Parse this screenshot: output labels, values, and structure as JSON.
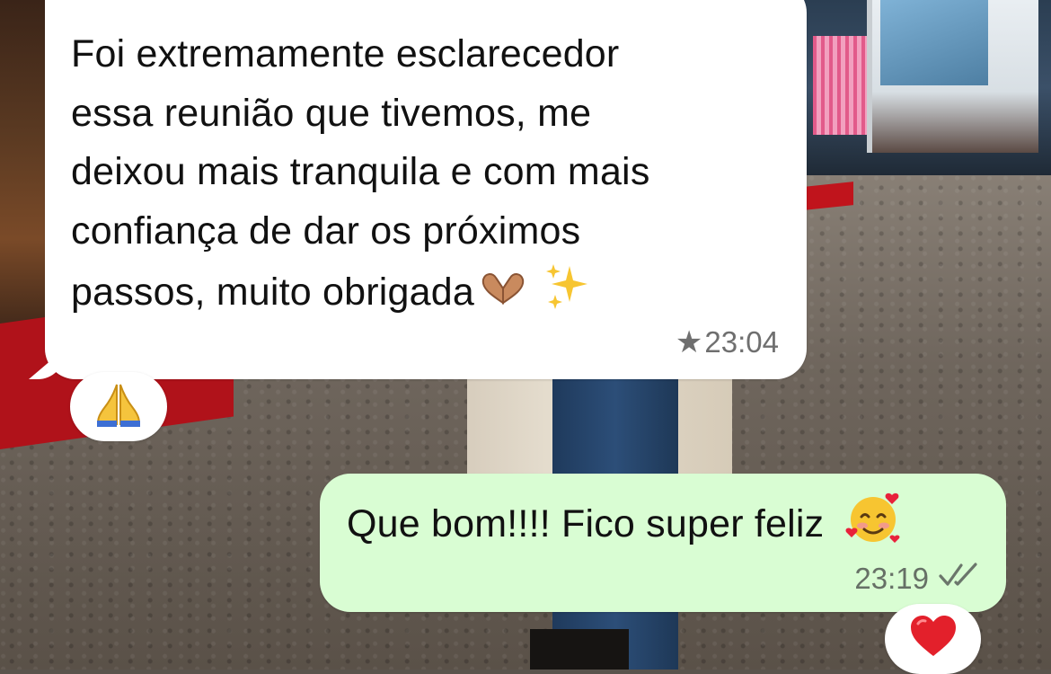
{
  "incoming_message": {
    "text": "Foi extremamente esclarecedor\nessa reunião que tivemos, me\ndeixou mais tranquila e com mais\nconfiança de dar os próximos\npassos, muito obrigada",
    "emojis": [
      "heart-hands-icon",
      "sparkles-icon"
    ],
    "time": "23:04",
    "starred": true,
    "reaction": "folded-hands-icon"
  },
  "outgoing_message": {
    "text": "Que bom!!!! Fico super feliz",
    "emoji": "smiling-face-with-hearts-icon",
    "time": "23:19",
    "status": "read-double-check-icon",
    "reaction": "red-heart-icon"
  },
  "colors": {
    "incoming_bubble": "#ffffff",
    "outgoing_bubble": "#d9fdd3",
    "meta_text": "#6f6f6f"
  }
}
